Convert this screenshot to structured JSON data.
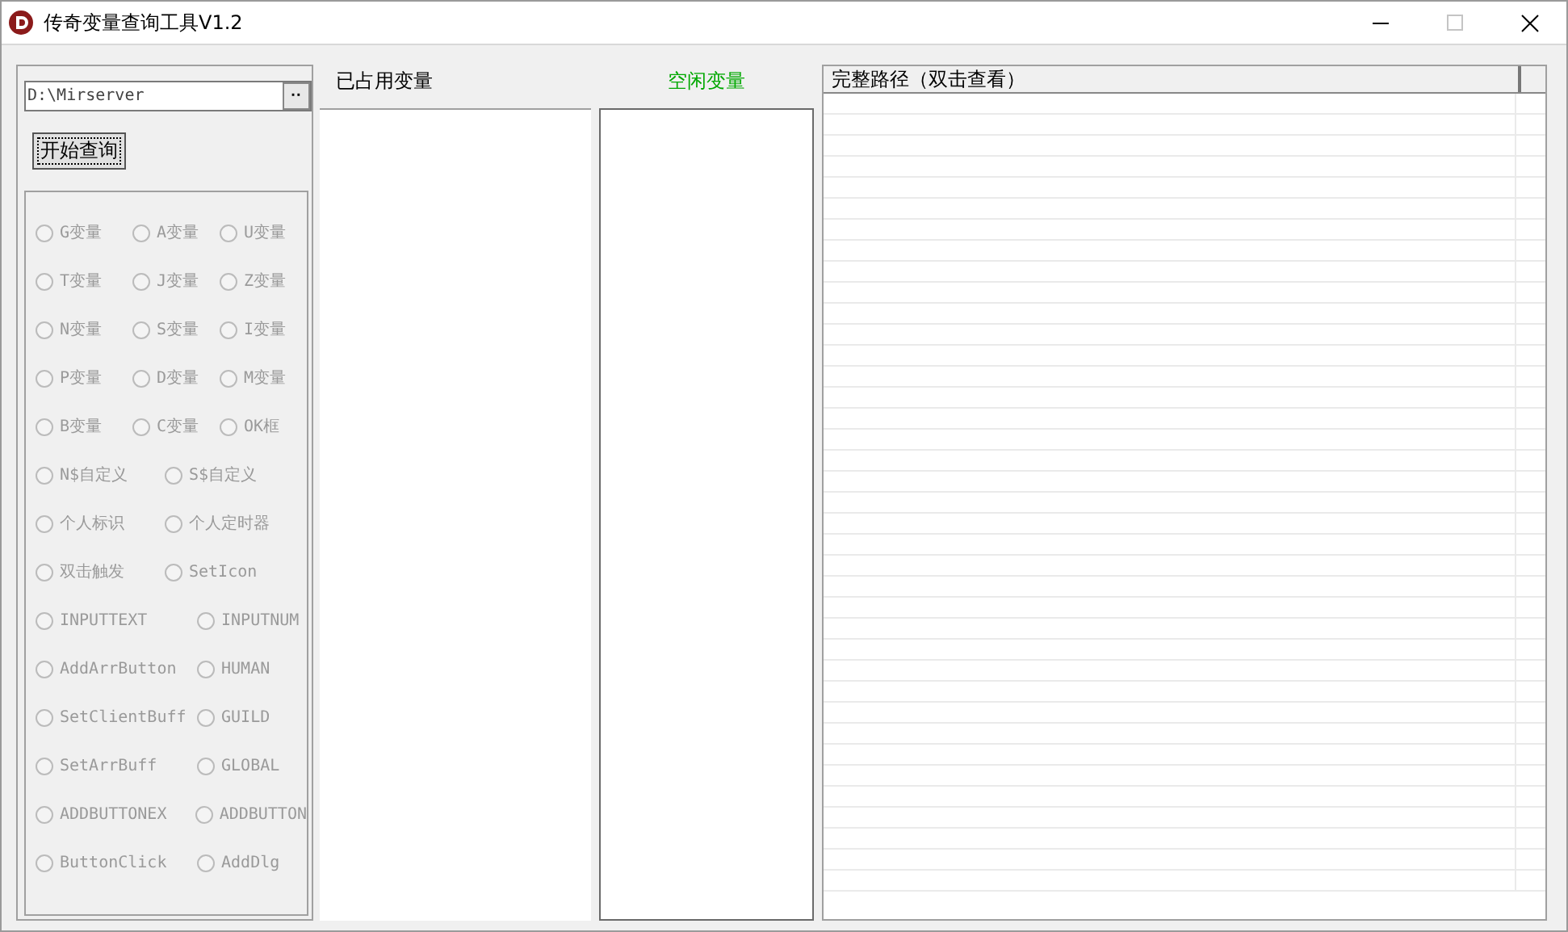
{
  "window": {
    "title": "传奇变量查询工具V1.2",
    "maximize_disabled": true
  },
  "path_field": {
    "value": "D:\\Mirserver",
    "browse_label": "··"
  },
  "query_button": {
    "label": "开始查询"
  },
  "variable_types": [
    [
      {
        "label": "G变量",
        "selected": false,
        "disabled": true
      },
      {
        "label": "A变量",
        "selected": false,
        "disabled": true
      },
      {
        "label": "U变量",
        "selected": false,
        "disabled": true
      }
    ],
    [
      {
        "label": "T变量",
        "selected": false,
        "disabled": true
      },
      {
        "label": "J变量",
        "selected": false,
        "disabled": true
      },
      {
        "label": "Z变量",
        "selected": false,
        "disabled": true
      }
    ],
    [
      {
        "label": "N变量",
        "selected": false,
        "disabled": true
      },
      {
        "label": "S变量",
        "selected": false,
        "disabled": true
      },
      {
        "label": "I变量",
        "selected": false,
        "disabled": true
      }
    ],
    [
      {
        "label": "P变量",
        "selected": false,
        "disabled": true
      },
      {
        "label": "D变量",
        "selected": false,
        "disabled": true
      },
      {
        "label": "M变量",
        "selected": false,
        "disabled": true
      }
    ],
    [
      {
        "label": "B变量",
        "selected": false,
        "disabled": true
      },
      {
        "label": "C变量",
        "selected": false,
        "disabled": true
      },
      {
        "label": "OK框",
        "selected": false,
        "disabled": true
      }
    ],
    [
      {
        "label": "N$自定义",
        "selected": false,
        "disabled": true
      },
      {
        "label": "S$自定义",
        "selected": false,
        "disabled": true
      }
    ],
    [
      {
        "label": "个人标识",
        "selected": false,
        "disabled": true
      },
      {
        "label": "个人定时器",
        "selected": false,
        "disabled": true
      }
    ],
    [
      {
        "label": "双击触发",
        "selected": false,
        "disabled": true
      },
      {
        "label": "SetIcon",
        "selected": false,
        "disabled": true
      }
    ],
    [
      {
        "label": "INPUTTEXT",
        "selected": false,
        "disabled": true
      },
      {
        "label": "INPUTNUM",
        "selected": false,
        "disabled": true
      }
    ],
    [
      {
        "label": "AddArrButton",
        "selected": false,
        "disabled": true
      },
      {
        "label": "HUMAN",
        "selected": false,
        "disabled": true
      }
    ],
    [
      {
        "label": "SetClientBuff",
        "selected": false,
        "disabled": true
      },
      {
        "label": "GUILD",
        "selected": false,
        "disabled": true
      }
    ],
    [
      {
        "label": "SetArrBuff",
        "selected": false,
        "disabled": true
      },
      {
        "label": "GLOBAL",
        "selected": false,
        "disabled": true
      }
    ],
    [
      {
        "label": "ADDBUTTONEX",
        "selected": false,
        "disabled": true
      },
      {
        "label": "ADDBUTTON",
        "selected": false,
        "disabled": true
      }
    ],
    [
      {
        "label": "ButtonClick",
        "selected": false,
        "disabled": true
      },
      {
        "label": "AddDlg",
        "selected": false,
        "disabled": true
      }
    ]
  ],
  "used_list": {
    "title": "已占用变量"
  },
  "free_list": {
    "title": "空闲变量"
  },
  "path_table": {
    "columns": [
      "完整路径（双击查看）"
    ]
  }
}
